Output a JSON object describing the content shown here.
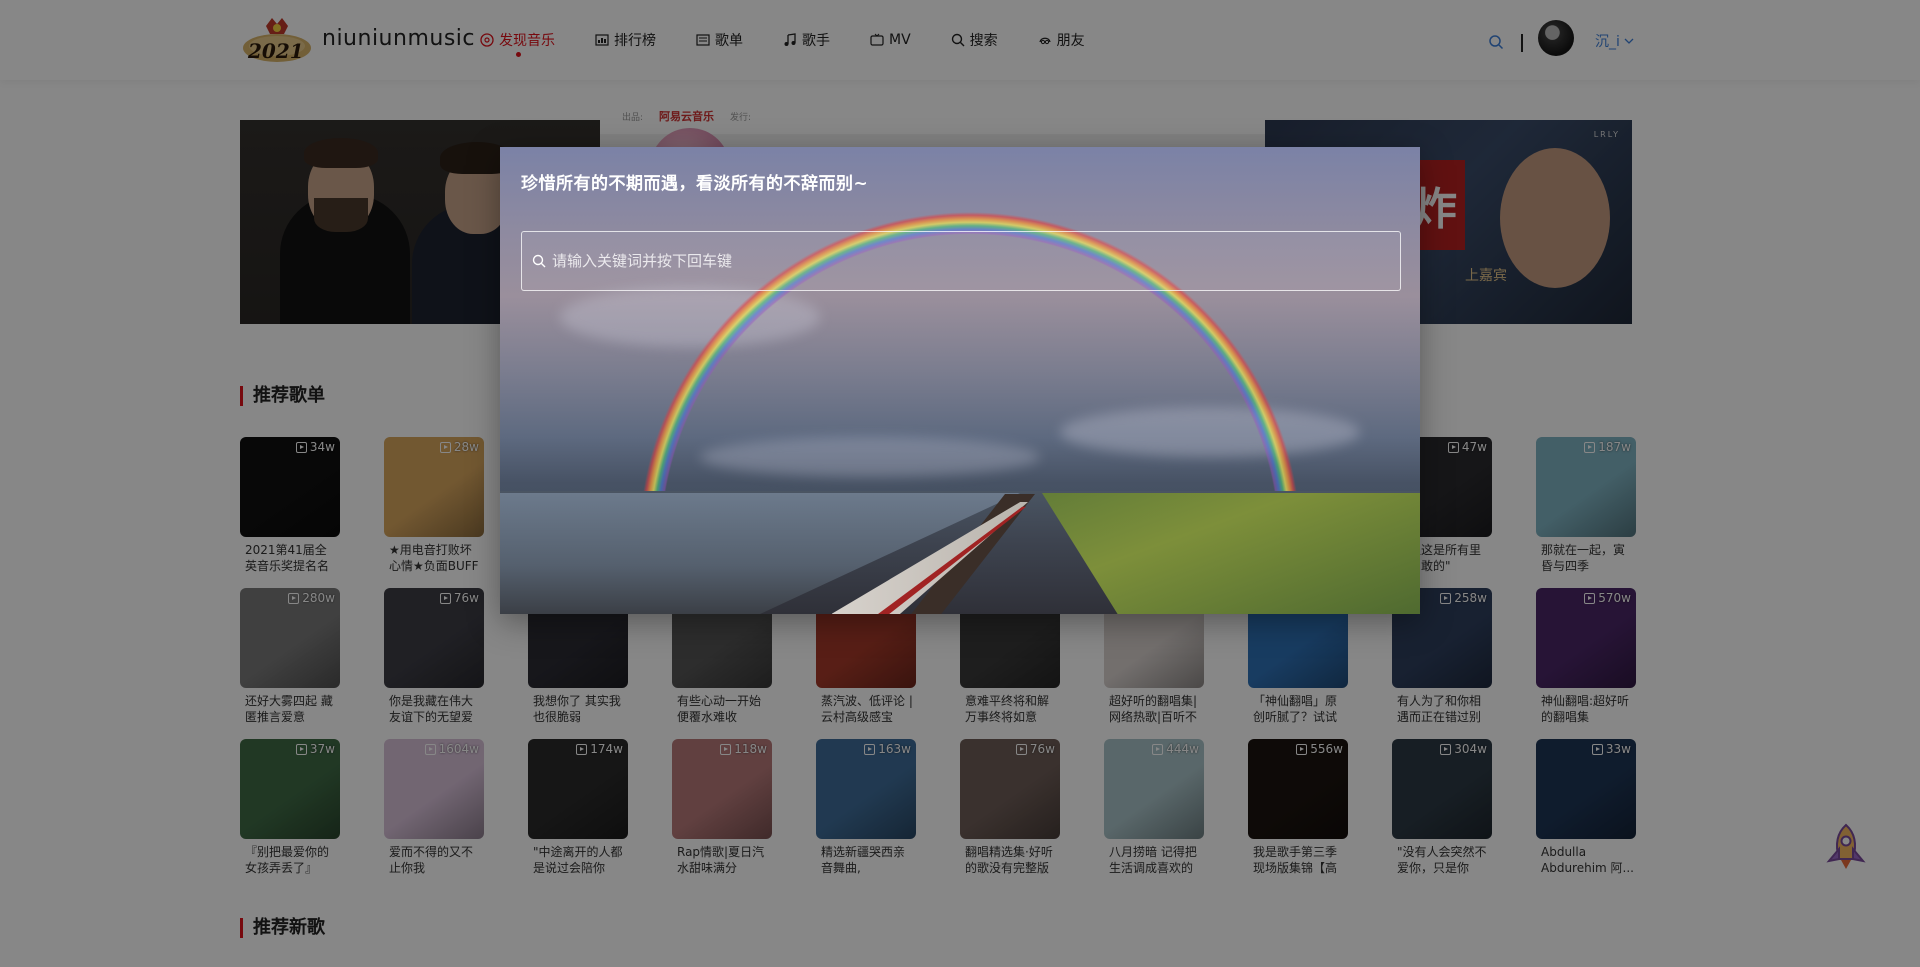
{
  "header": {
    "brand": "niuniunmusic",
    "logo_text": "2021",
    "nav": [
      {
        "label": "发现音乐",
        "icon": "disc-icon",
        "active": true
      },
      {
        "label": "排行榜",
        "icon": "chart-icon",
        "active": false
      },
      {
        "label": "歌单",
        "icon": "list-icon",
        "active": false
      },
      {
        "label": "歌手",
        "icon": "note-icon",
        "active": false
      },
      {
        "label": "MV",
        "icon": "tv-icon",
        "active": false
      },
      {
        "label": "搜索",
        "icon": "search-icon",
        "active": false
      },
      {
        "label": "朋友",
        "icon": "friends-icon",
        "active": false
      }
    ],
    "username": "沉_i",
    "divider": "|"
  },
  "banner": {
    "center_strip": [
      "出品:",
      "阿易云音乐",
      "发行:"
    ],
    "right_sign": "炸",
    "right_sub": "上嘉宾",
    "right_tag": "LRLY"
  },
  "sections": {
    "playlists_title": "推荐歌单",
    "newsongs_title": "推荐新歌"
  },
  "playlists": [
    {
      "title": "2021第41届全英音乐奖提名名单",
      "plays": "34w",
      "bg": "#101010",
      "fg": "#ffffff"
    },
    {
      "title": "★用电音打败坏心情★负面BUFF快...",
      "plays": "28w",
      "bg": "#d8a65e",
      "fg": "#1e1e1e"
    },
    {
      "title": "",
      "plays": "",
      "bg": "#444",
      "fg": "#fff"
    },
    {
      "title": "",
      "plays": "",
      "bg": "#444",
      "fg": "#fff"
    },
    {
      "title": "",
      "plays": "",
      "bg": "#444",
      "fg": "#fff"
    },
    {
      "title": "",
      "plays": "",
      "bg": "#444",
      "fg": "#fff"
    },
    {
      "title": "",
      "plays": "",
      "bg": "#444",
      "fg": "#fff"
    },
    {
      "title": "",
      "plays": "",
      "bg": "#444",
      "fg": "#fff"
    },
    {
      "title": "声遇这是所有里最勇敢的\"",
      "plays": "47w",
      "bg": "#2a2a2e",
      "fg": "#fff"
    },
    {
      "title": "那就在一起，寅昏与四季",
      "plays": "187w",
      "bg": "#7fb3c2",
      "fg": "#fff"
    },
    {
      "title": "还好大雾四起 藏匿推言爱意",
      "plays": "280w",
      "bg": "#7a7a7a",
      "fg": "#fff"
    },
    {
      "title": "你是我藏在伟大友谊下的无望爱人",
      "plays": "76w",
      "bg": "#3d3d45",
      "fg": "#fff"
    },
    {
      "title": "我想你了 其实我也很脆弱",
      "plays": "",
      "bg": "#2c2c34",
      "fg": "#fff"
    },
    {
      "title": "有些心动一开始便覆水难收",
      "plays": "",
      "bg": "#555555",
      "fg": "#fff"
    },
    {
      "title": "蒸汽波、低评论 | 云村高级感宝藏...",
      "plays": "",
      "bg": "#a63a2a",
      "fg": "#fff"
    },
    {
      "title": "意难平终将和解 万事终将如意",
      "plays": "",
      "bg": "#3a3a3a",
      "fg": "#fff"
    },
    {
      "title": "超好听的翻唱集|网络热歌|百听不厌",
      "plays": "",
      "bg": "#d9d2cf",
      "fg": "#fff"
    },
    {
      "title": "「神仙翻唱」原创听腻了？试试这...",
      "plays": "",
      "bg": "#2f72b8",
      "fg": "#fff"
    },
    {
      "title": "有人为了和你相遇而正在错过别人",
      "plays": "258w",
      "bg": "#2e3f5e",
      "fg": "#fff"
    },
    {
      "title": "神仙翻唱:超好听的翻唱集",
      "plays": "570w",
      "bg": "#4a2666",
      "fg": "#fff"
    },
    {
      "title": "『别把最爱你的女孩弄丢了』 mun...",
      "plays": "37w",
      "bg": "#3f6a45",
      "fg": "#fff"
    },
    {
      "title": "爱而不得的又不止你我",
      "plays": "1604w",
      "bg": "#d7c0d8",
      "fg": "#fff"
    },
    {
      "title": "\"中途离开的人都是说过会陪你好...",
      "plays": "174w",
      "bg": "#2a2a2a",
      "fg": "#fff"
    },
    {
      "title": "Rap情歌|夏日汽水甜味满分",
      "plays": "118w",
      "bg": "#b87a7a",
      "fg": "#fff"
    },
    {
      "title": "精选新疆哭西亲音舞曲,",
      "plays": "163w",
      "bg": "#3f6d99",
      "fg": "#fff"
    },
    {
      "title": "翻唱精选集·好听的歌没有完整版系列",
      "plays": "76w",
      "bg": "#6e5d57",
      "fg": "#fff"
    },
    {
      "title": "八月捞暗 记得把生活调成喜欢的频道",
      "plays": "444w",
      "bg": "#a9c3c8",
      "fg": "#fff"
    },
    {
      "title": "我是歌手第三季现场版集锦【高品...",
      "plays": "556w",
      "bg": "#1c1410",
      "fg": "#fff"
    },
    {
      "title": "\"没有人会突然不爱你，只是你突...",
      "plays": "304w",
      "bg": "#2d3a45",
      "fg": "#fff"
    },
    {
      "title": "Abdulla Abdurehim 阿...",
      "plays": "33w",
      "bg": "#1e3555",
      "fg": "#fff"
    }
  ],
  "modal": {
    "quote": "珍惜所有的不期而遇，看淡所有的不辞而别~",
    "search_placeholder": "请输入关键词并按下回车键",
    "search_value": ""
  }
}
